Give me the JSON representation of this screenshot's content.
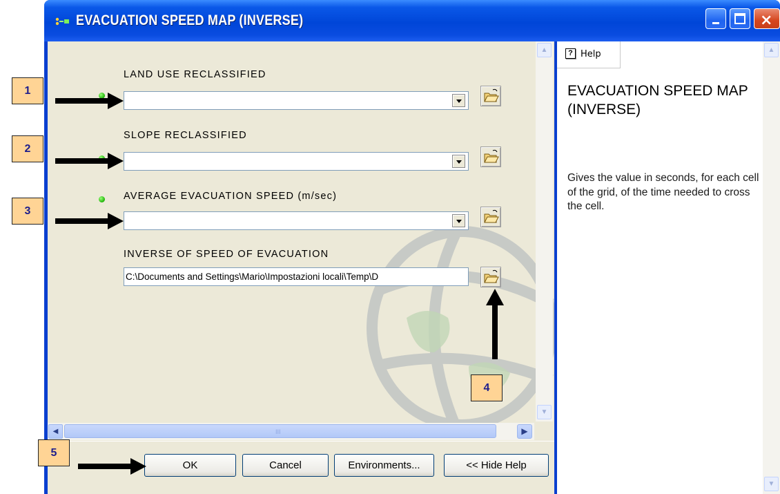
{
  "window": {
    "title": "EVACUATION SPEED MAP (INVERSE)",
    "controls": {
      "minimize": "minimize",
      "maximize": "maximize",
      "close": "×"
    }
  },
  "form": {
    "fields": [
      {
        "label": "LAND USE RECLASSIFIED",
        "required": true,
        "value": ""
      },
      {
        "label": "SLOPE RECLASSIFIED",
        "required": true,
        "value": ""
      },
      {
        "label": "AVERAGE EVACUATION SPEED (m/sec)",
        "required": true,
        "value": ""
      },
      {
        "label": "INVERSE OF SPEED OF EVACUATION",
        "required": false,
        "value": "C:\\Documents and Settings\\Mario\\Impostazioni locali\\Temp\\D"
      }
    ],
    "browse_icon": "open-folder-icon",
    "scroll_grip": "III"
  },
  "buttons": {
    "ok": "OK",
    "cancel": "Cancel",
    "environments": "Environments...",
    "hide_help": "<< Hide Help"
  },
  "help": {
    "tab_icon": "?",
    "tab_label": "Help",
    "title": "EVACUATION SPEED MAP (INVERSE)",
    "body": "Gives the value in seconds, for each cell of the grid, of the time needed to cross the cell."
  },
  "annotations": [
    "1",
    "2",
    "3",
    "4",
    "5"
  ],
  "colors": {
    "titlebar": "#0054e3",
    "dialog_bg": "#ece9d8",
    "required_dot": "#22b00c",
    "badge": "#ffd495",
    "badge_text": "#1d1d8c"
  }
}
